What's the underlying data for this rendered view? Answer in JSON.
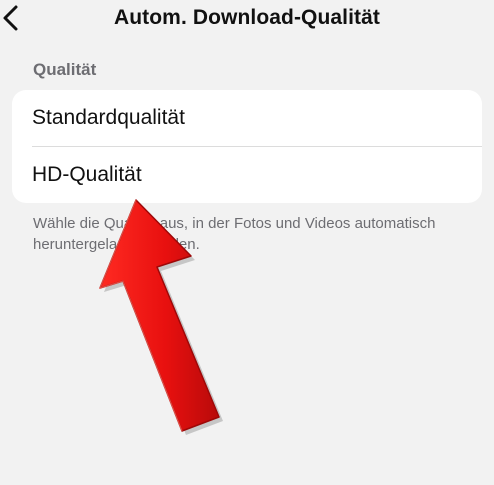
{
  "nav": {
    "title": "Autom. Download-Qualität",
    "back_icon": "chevron-left-icon"
  },
  "section": {
    "header": "Qualität"
  },
  "options": [
    {
      "label": "Standardqualität"
    },
    {
      "label": "HD-Qualität"
    }
  ],
  "footer": {
    "text": "Wähle die Qualität aus, in der Fotos und Videos automatisch heruntergeladen werden."
  },
  "annotation": {
    "arrow_icon": "red-arrow-icon",
    "arrow_color": "#e8100f"
  },
  "colors": {
    "background": "#f2f2f2",
    "card": "#ffffff",
    "secondary_text": "#6d6d72"
  }
}
